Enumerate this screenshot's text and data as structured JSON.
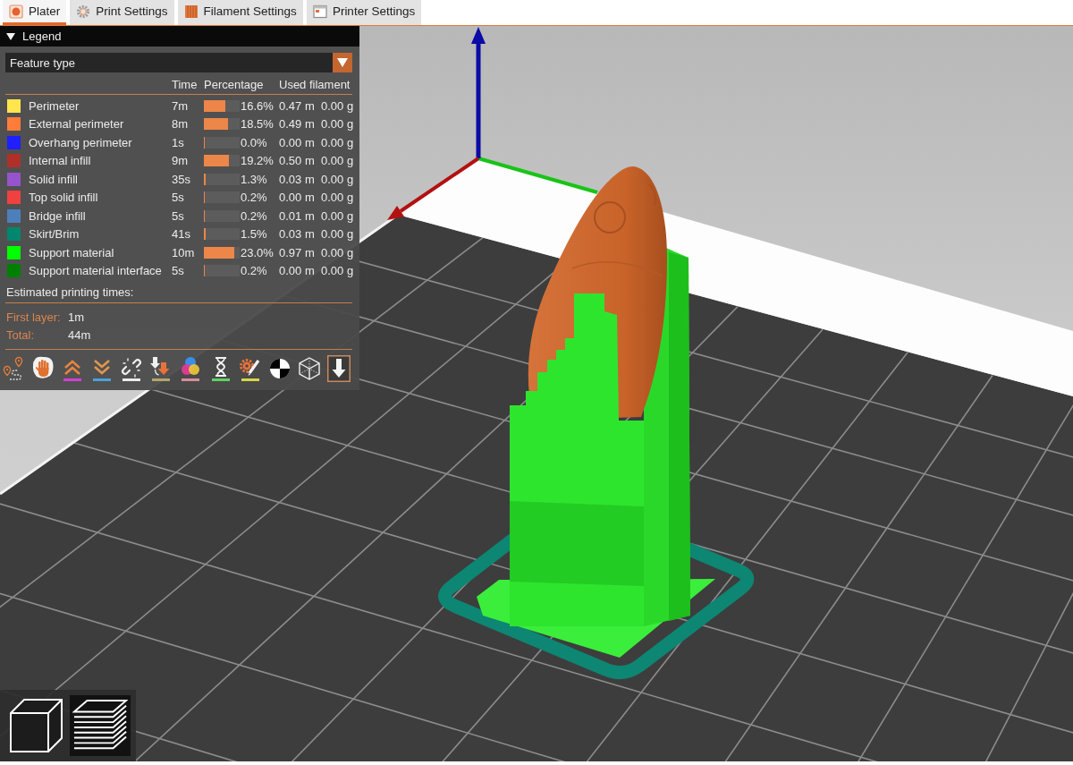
{
  "tabs": [
    {
      "label": "Plater",
      "kind": "plater",
      "selected": true
    },
    {
      "label": "Print Settings",
      "kind": "print",
      "selected": false
    },
    {
      "label": "Filament Settings",
      "kind": "filament",
      "selected": false
    },
    {
      "label": "Printer Settings",
      "kind": "printer",
      "selected": false
    }
  ],
  "legend": {
    "title": "Legend",
    "expanded": true,
    "view_type": "Feature type",
    "columns": [
      "Time",
      "Percentage",
      "Used filament"
    ],
    "rows": [
      {
        "name": "Perimeter",
        "color": "#ffe64d",
        "time": "7m",
        "level": 0.61,
        "percentage": "16.6%",
        "length": "0.47 m",
        "weight": "0.00 g"
      },
      {
        "name": "External perimeter",
        "color": "#ff7d38",
        "time": "8m",
        "level": 0.68,
        "percentage": "18.5%",
        "length": "0.49 m",
        "weight": "0.00 g"
      },
      {
        "name": "Overhang perimeter",
        "color": "#1f1fff",
        "time": "1s",
        "level": 0,
        "percentage": "0.0%",
        "length": "0.00 m",
        "weight": "0.00 g"
      },
      {
        "name": "Internal infill",
        "color": "#b03029",
        "time": "9m",
        "level": 0.71,
        "percentage": "19.2%",
        "length": "0.50 m",
        "weight": "0.00 g"
      },
      {
        "name": "Solid infill",
        "color": "#9654cc",
        "time": "35s",
        "level": 0.05,
        "percentage": "1.3%",
        "length": "0.03 m",
        "weight": "0.00 g"
      },
      {
        "name": "Top solid infill",
        "color": "#f04040",
        "time": "5s",
        "level": 0.01,
        "percentage": "0.2%",
        "length": "0.00 m",
        "weight": "0.00 g"
      },
      {
        "name": "Bridge infill",
        "color": "#4d80ba",
        "time": "5s",
        "level": 0.01,
        "percentage": "0.2%",
        "length": "0.01 m",
        "weight": "0.00 g"
      },
      {
        "name": "Skirt/Brim",
        "color": "#00876e",
        "time": "41s",
        "level": 0.06,
        "percentage": "1.5%",
        "length": "0.03 m",
        "weight": "0.00 g"
      },
      {
        "name": "Support material",
        "color": "#00ff00",
        "time": "10m",
        "level": 0.85,
        "percentage": "23.0%",
        "length": "0.97 m",
        "weight": "0.00 g"
      },
      {
        "name": "Support material interface",
        "color": "#008000",
        "time": "5s",
        "level": 0.01,
        "percentage": "0.2%",
        "length": "0.00 m",
        "weight": "0.00 g"
      }
    ],
    "estimate_title": "Estimated printing times:",
    "estimates": [
      {
        "label": "First layer:",
        "value": "1m"
      },
      {
        "label": "Total:",
        "value": "44m"
      }
    ],
    "toggles": [
      {
        "kind": "travel",
        "on": false
      },
      {
        "kind": "wipe",
        "on": false
      },
      {
        "kind": "retractions",
        "on": false
      },
      {
        "kind": "deretractions",
        "on": false
      },
      {
        "kind": "seams",
        "on": false
      },
      {
        "kind": "toolchanges",
        "on": false
      },
      {
        "kind": "colorchanges",
        "on": false
      },
      {
        "kind": "pauses",
        "on": false
      },
      {
        "kind": "customgcodes",
        "on": false
      },
      {
        "kind": "gravity",
        "on": false
      },
      {
        "kind": "shells",
        "on": false
      },
      {
        "kind": "toolmarker",
        "on": true
      }
    ]
  },
  "view_buttons": [
    {
      "kind": "model",
      "selected": false
    },
    {
      "kind": "preview",
      "selected": true
    }
  ]
}
